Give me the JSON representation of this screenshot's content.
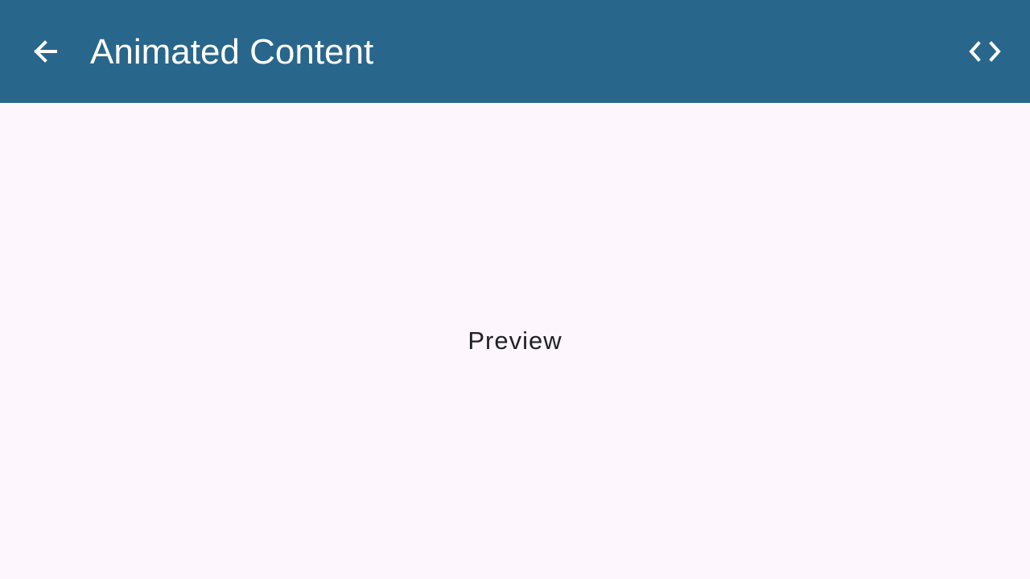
{
  "app_bar": {
    "title": "Animated Content",
    "back_icon": "arrow-back-icon",
    "code_icon": "code-icon",
    "background_color": "#29668b",
    "foreground_color": "#ffffff"
  },
  "content": {
    "preview_label": "Preview",
    "background_color": "#fdf7fd",
    "text_color": "#222126"
  }
}
